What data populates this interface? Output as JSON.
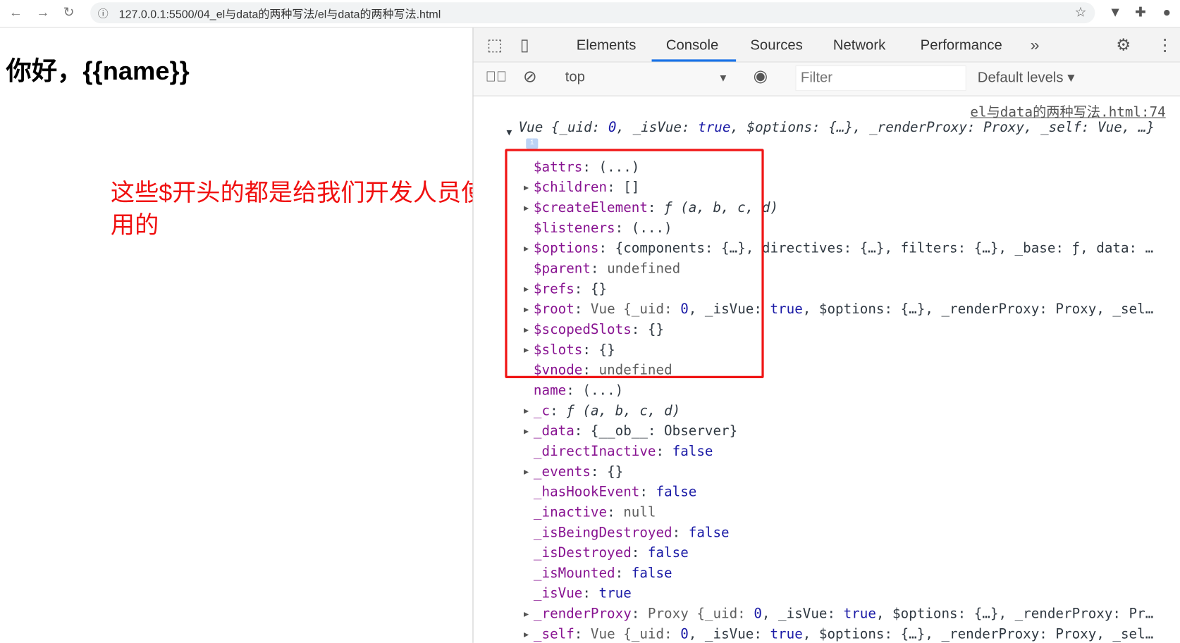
{
  "browser": {
    "url": "127.0.0.1:5500/04_el与data的两种写法/el与data的两种写法.html"
  },
  "page": {
    "heading": "你好，{{name}}",
    "annotation": "这些$开头的都是给我们开发人员使用的"
  },
  "devtools": {
    "tabs": [
      "Elements",
      "Console",
      "Sources",
      "Network",
      "Performance"
    ],
    "active_tab": "Console",
    "context": "top",
    "filter_placeholder": "Filter",
    "levels": "Default levels ▾",
    "source_link": "el与data的两种写法.html:74",
    "header": [
      [
        "Vue {_uid: ",
        ""
      ],
      [
        "0",
        "t-num"
      ],
      [
        ", _isVue: ",
        ""
      ],
      [
        "true",
        "t-bool"
      ],
      [
        ", $options: {…}, _renderProxy: Proxy, _self: Vue, …}",
        ""
      ]
    ],
    "rows": [
      {
        "exp": false,
        "key": "$attrs",
        "val": [
          [
            "(...)",
            ""
          ]
        ]
      },
      {
        "exp": true,
        "key": "$children",
        "val": [
          [
            "[]",
            ""
          ]
        ]
      },
      {
        "exp": true,
        "key": "$createElement",
        "val": [
          [
            "ƒ (a, b, c, d)",
            "t-it"
          ]
        ]
      },
      {
        "exp": false,
        "key": "$listeners",
        "val": [
          [
            "(...)",
            ""
          ]
        ]
      },
      {
        "exp": true,
        "key": "$options",
        "val": [
          [
            "{components: {…}, directives: {…}, filters: {…}, _base: ƒ, data: …",
            ""
          ]
        ]
      },
      {
        "exp": false,
        "key": "$parent",
        "val": [
          [
            "undefined",
            "t-undef"
          ]
        ]
      },
      {
        "exp": true,
        "key": "$refs",
        "val": [
          [
            "{}",
            ""
          ]
        ]
      },
      {
        "exp": true,
        "key": "$root",
        "val": [
          [
            "Vue {_uid: ",
            "t-undef"
          ],
          [
            "0",
            "t-num"
          ],
          [
            ", _isVue: ",
            ""
          ],
          [
            "true",
            "t-bool"
          ],
          [
            ", $options: {…}, _renderProxy: Proxy, _sel…",
            ""
          ]
        ]
      },
      {
        "exp": true,
        "key": "$scopedSlots",
        "val": [
          [
            "{}",
            ""
          ]
        ]
      },
      {
        "exp": true,
        "key": "$slots",
        "val": [
          [
            "{}",
            ""
          ]
        ]
      },
      {
        "exp": false,
        "key": "$vnode",
        "val": [
          [
            "undefined",
            "t-undef"
          ]
        ]
      },
      {
        "exp": false,
        "key": "name",
        "val": [
          [
            "(...)",
            ""
          ]
        ]
      },
      {
        "exp": true,
        "key": "_c",
        "val": [
          [
            "ƒ (a, b, c, d)",
            "t-it"
          ]
        ]
      },
      {
        "exp": true,
        "key": "_data",
        "val": [
          [
            "{__ob__: Observer}",
            ""
          ]
        ]
      },
      {
        "exp": false,
        "key": "_directInactive",
        "val": [
          [
            "false",
            "t-bool"
          ]
        ]
      },
      {
        "exp": true,
        "key": "_events",
        "val": [
          [
            "{}",
            ""
          ]
        ]
      },
      {
        "exp": false,
        "key": "_hasHookEvent",
        "val": [
          [
            "false",
            "t-bool"
          ]
        ]
      },
      {
        "exp": false,
        "key": "_inactive",
        "val": [
          [
            "null",
            "t-undef"
          ]
        ]
      },
      {
        "exp": false,
        "key": "_isBeingDestroyed",
        "val": [
          [
            "false",
            "t-bool"
          ]
        ]
      },
      {
        "exp": false,
        "key": "_isDestroyed",
        "val": [
          [
            "false",
            "t-bool"
          ]
        ]
      },
      {
        "exp": false,
        "key": "_isMounted",
        "val": [
          [
            "false",
            "t-bool"
          ]
        ]
      },
      {
        "exp": false,
        "key": "_isVue",
        "val": [
          [
            "true",
            "t-bool"
          ]
        ]
      },
      {
        "exp": true,
        "key": "_renderProxy",
        "val": [
          [
            "Proxy {_uid: ",
            "t-undef"
          ],
          [
            "0",
            "t-num"
          ],
          [
            ", _isVue: ",
            ""
          ],
          [
            "true",
            "t-bool"
          ],
          [
            ", $options: {…}, _renderProxy: Pr…",
            ""
          ]
        ]
      },
      {
        "exp": true,
        "key": "_self",
        "val": [
          [
            "Vue {_uid: ",
            "t-undef"
          ],
          [
            "0",
            "t-num"
          ],
          [
            ", _isVue: ",
            ""
          ],
          [
            "true",
            "t-bool"
          ],
          [
            ", $options: {…}, _renderProxy: Proxy, _sel…",
            ""
          ]
        ]
      }
    ]
  },
  "colors": {
    "highlight_box": "#f01515",
    "annotation": "#f01010",
    "property": "#881391",
    "keyword": "#1a1aa6"
  }
}
